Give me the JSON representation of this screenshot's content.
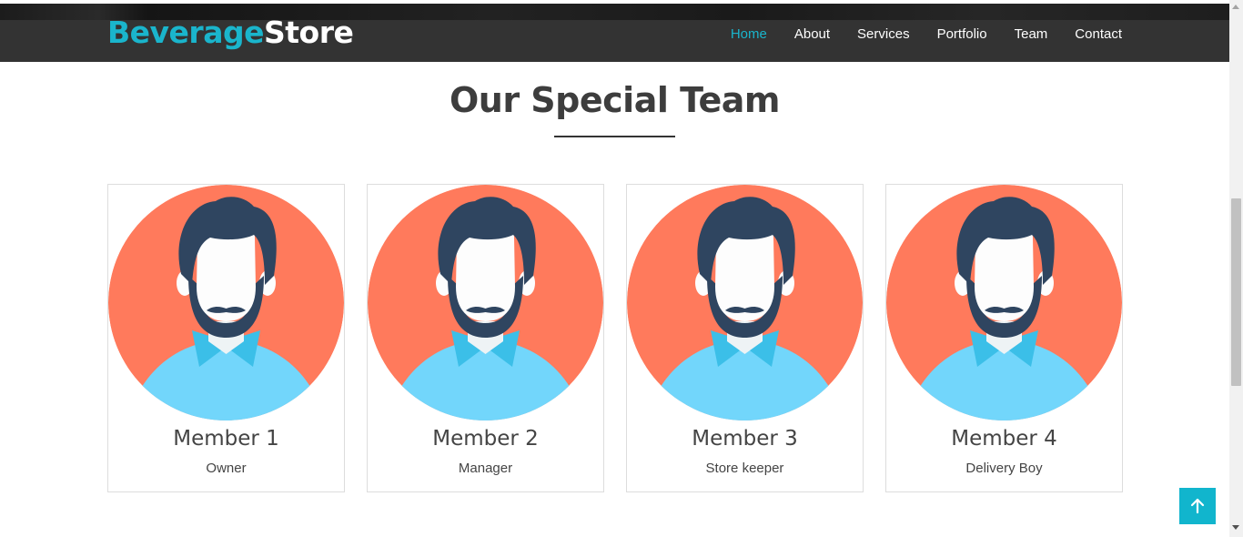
{
  "brand": {
    "part1": "Beverage",
    "part2": "Store"
  },
  "nav": {
    "items": [
      {
        "label": "Home",
        "active": true
      },
      {
        "label": "About"
      },
      {
        "label": "Services"
      },
      {
        "label": "Portfolio"
      },
      {
        "label": "Team"
      },
      {
        "label": "Contact"
      }
    ]
  },
  "section": {
    "title": "Our Special Team"
  },
  "team": [
    {
      "name": "Member 1",
      "role": "Owner"
    },
    {
      "name": "Member 2",
      "role": "Manager"
    },
    {
      "name": "Member 3",
      "role": "Store keeper"
    },
    {
      "name": "Member 4",
      "role": "Delivery Boy"
    }
  ],
  "colors": {
    "accent": "#1ab5cc",
    "navbar": "#333333",
    "avatar_bg": "#ff7a5c",
    "hair": "#2f4560",
    "shirt": "#72d6fb",
    "collar": "#3bbfe8",
    "face": "#fdfdfd",
    "to_top": "#11b5cd"
  },
  "icons": {
    "back_to_top": "arrow-up-icon"
  }
}
